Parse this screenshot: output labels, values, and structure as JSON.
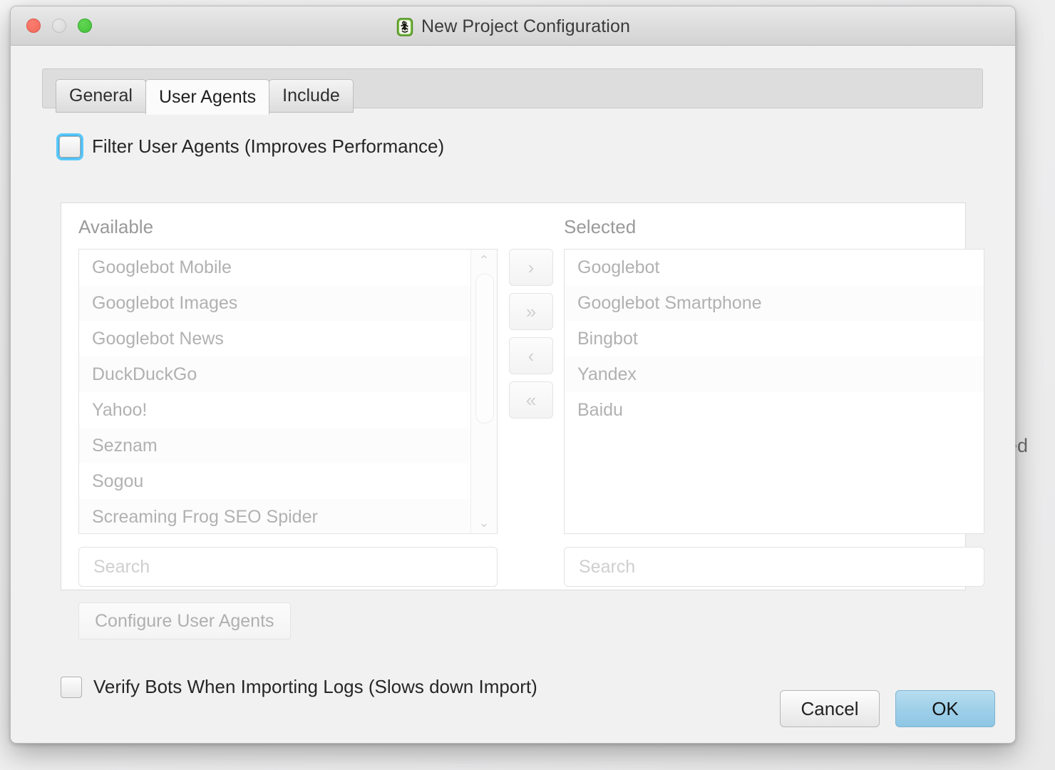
{
  "window": {
    "title": "New Project Configuration",
    "app_icon": "screaming-frog-icon",
    "controls": {
      "close": "close",
      "minimize": "minimize",
      "maximize": "maximize"
    }
  },
  "backdrop": {
    "partial_text": "ed"
  },
  "tabs": [
    {
      "label": "General",
      "active": false
    },
    {
      "label": "User Agents",
      "active": true
    },
    {
      "label": "Include",
      "active": false
    }
  ],
  "filter": {
    "label": "Filter User Agents (Improves Performance)",
    "checked": false,
    "focused": true
  },
  "transfer": {
    "buttons": [
      {
        "name": "move-right-button",
        "glyph": "›"
      },
      {
        "name": "move-all-right-button",
        "glyph": "»"
      },
      {
        "name": "move-left-button",
        "glyph": "‹"
      },
      {
        "name": "move-all-left-button",
        "glyph": "«"
      }
    ]
  },
  "available": {
    "title": "Available",
    "items": [
      "Googlebot Mobile",
      "Googlebot Images",
      "Googlebot News",
      "DuckDuckGo",
      "Yahoo!",
      "Seznam",
      "Sogou",
      "Screaming Frog SEO Spider"
    ],
    "search_placeholder": "Search",
    "search_value": "",
    "scrollbar": {
      "up_glyph": "⌃",
      "down_glyph": "⌄"
    }
  },
  "selected": {
    "title": "Selected",
    "items": [
      "Googlebot",
      "Googlebot Smartphone",
      "Bingbot",
      "Yandex",
      "Baidu"
    ],
    "search_placeholder": "Search",
    "search_value": ""
  },
  "configure": {
    "label": "Configure User Agents",
    "enabled": false
  },
  "verify": {
    "label": "Verify Bots When Importing Logs (Slows down Import)",
    "checked": false
  },
  "footer": {
    "cancel_label": "Cancel",
    "ok_label": "OK"
  },
  "colors": {
    "accent_default_button": "#9fd0e9",
    "focus_ring": "#5ac8fa",
    "disabled_text": "#b1b1b1",
    "title_text": "#3b3b3b"
  }
}
